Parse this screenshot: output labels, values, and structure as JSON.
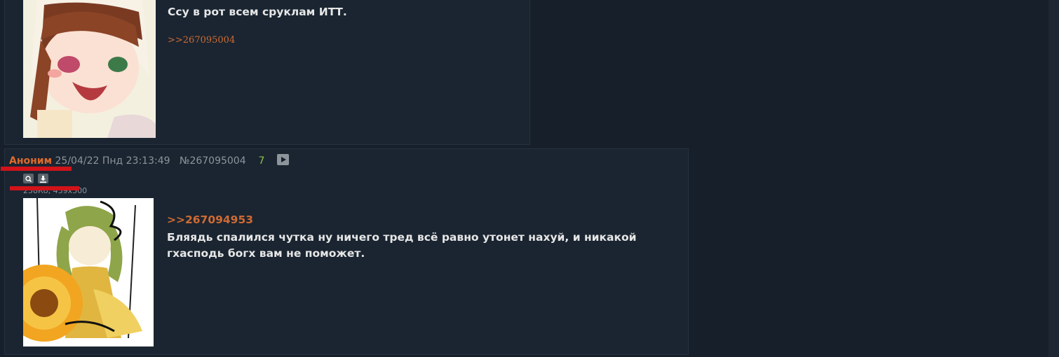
{
  "posts": [
    {
      "text": "Ссу в рот всем сруклам ИТТ.",
      "reply_link": ">>267095004"
    },
    {
      "author": "Аноним",
      "datetime": "25/04/22 Пнд 23:13:49",
      "number": "№267095004",
      "reply_count": "7",
      "file_info": "258Кб, 439x500",
      "reply_to": ">>267094953",
      "text_line1": "Бляядь спалился чутка ну ничего тред всё равно утонет нахуй, и никакой",
      "text_line2": "гхасподь богх вам не поможет.",
      "icons": [
        "search-icon",
        "download-icon",
        "play-icon"
      ]
    }
  ],
  "colors": {
    "accent": "#d06a33",
    "background": "#17202a",
    "post_bg": "#1a2531",
    "reply_count": "#8cc14a"
  }
}
